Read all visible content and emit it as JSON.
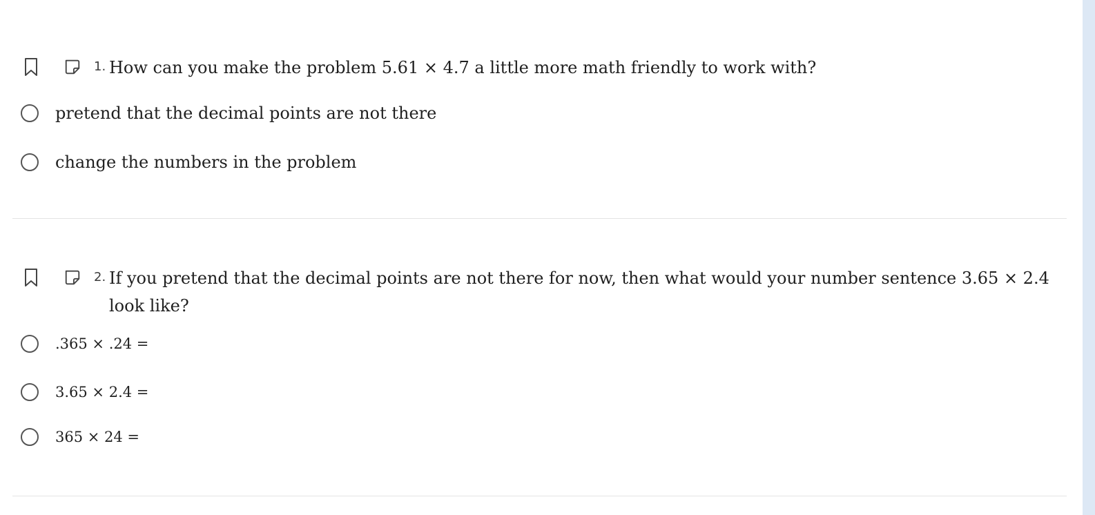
{
  "questions": [
    {
      "number": "1.",
      "text_before": "How can you make the problem ",
      "math": "5.61 × 4.7",
      "text_after": " a little more math friendly to work with?",
      "options": [
        "pretend that the decimal points are not there",
        "change the numbers in the problem"
      ]
    },
    {
      "number": "2.",
      "text_before": "If you pretend that the decimal points are not there for now, then what would your number sentence ",
      "math": "3.65 × 2.4",
      "text_after": " look like?",
      "options": [
        ".365 × .24 =",
        "3.65 × 2.4 =",
        "365 × 24 ="
      ]
    }
  ],
  "icons": {
    "bookmark": "bookmark-icon",
    "note": "note-icon",
    "radio": "radio-icon"
  },
  "colors": {
    "text": "#1f1f1f",
    "divider": "#e3e3e3",
    "scroll_rail": "#dde8f5"
  }
}
